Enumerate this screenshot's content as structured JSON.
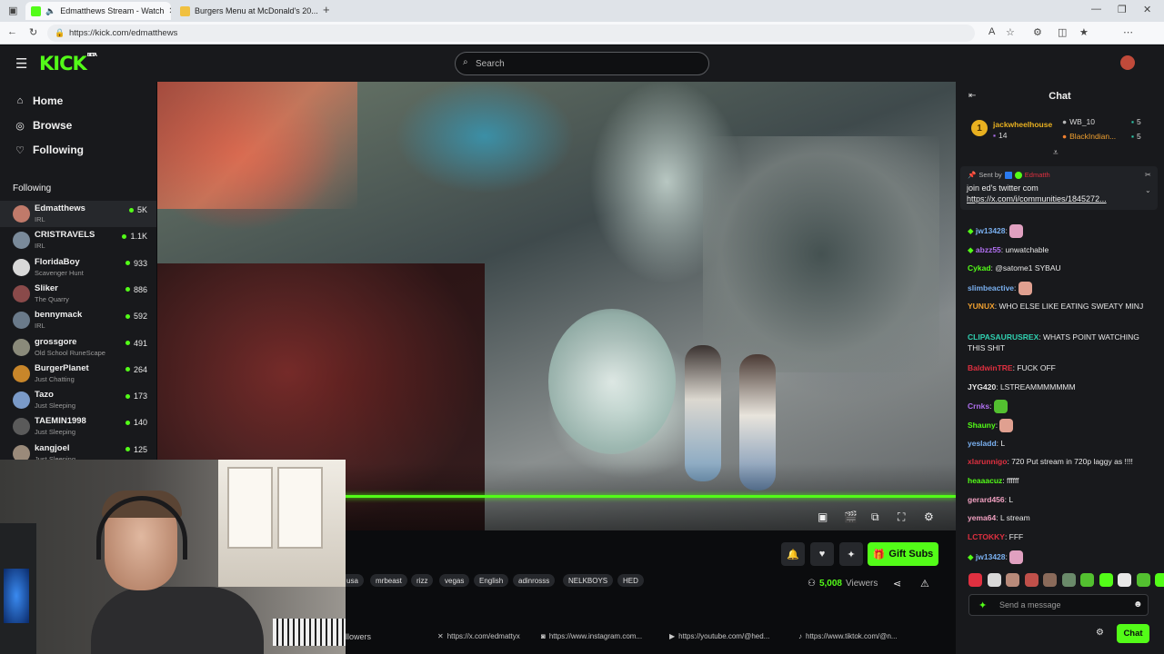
{
  "browser": {
    "tabs": [
      {
        "title": "Edmatthews Stream - Watch",
        "active": true
      },
      {
        "title": "Burgers Menu at McDonald's 20...",
        "active": false
      }
    ],
    "url": "https://kick.com/edmatthews",
    "new_tab_icon": "plus-icon"
  },
  "header": {
    "logo": "KICK",
    "logo_badge": "BETA",
    "search_placeholder": "Search"
  },
  "sidebar": {
    "nav": [
      {
        "label": "Home",
        "icon": "home-icon"
      },
      {
        "label": "Browse",
        "icon": "compass-icon"
      },
      {
        "label": "Following",
        "icon": "heart-icon"
      }
    ],
    "following_title": "Following",
    "channels": [
      {
        "name": "Edmatthews",
        "category": "IRL",
        "viewers": "5K",
        "color": "#c07a6a"
      },
      {
        "name": "CRISTRAVELS",
        "category": "IRL",
        "viewers": "1.1K",
        "color": "#7a8a9a"
      },
      {
        "name": "FloridaBoy",
        "category": "Scavenger Hunt",
        "viewers": "933",
        "color": "#d8d8d8"
      },
      {
        "name": "Sliker",
        "category": "The Quarry",
        "viewers": "886",
        "color": "#8a4a4a"
      },
      {
        "name": "bennymack",
        "category": "IRL",
        "viewers": "592",
        "color": "#6a7a8a"
      },
      {
        "name": "grossgore",
        "category": "Old School RuneScape",
        "viewers": "491",
        "color": "#8a8a7a"
      },
      {
        "name": "BurgerPlanet",
        "category": "Just Chatting",
        "viewers": "264",
        "color": "#c8862a"
      },
      {
        "name": "Tazo",
        "category": "Just Sleeping",
        "viewers": "173",
        "color": "#7a9ac8"
      },
      {
        "name": "TAEMIN1998",
        "category": "Just Sleeping",
        "viewers": "140",
        "color": "#5a5a5a"
      },
      {
        "name": "kangjoel",
        "category": "Just Sleeping",
        "viewers": "125",
        "color": "#9a8a7a"
      }
    ]
  },
  "stream": {
    "tags": [
      "usa",
      "mrbeast",
      "rizz",
      "vegas",
      "English",
      "adinrosss",
      "NELKBOYS",
      "HED"
    ],
    "viewers_count": "5,008",
    "viewers_label": "Viewers",
    "gift_subs_label": "Gift Subs",
    "followers_label": "llowers",
    "social_links": [
      {
        "icon": "x-icon",
        "text": "https://x.com/edmattyx"
      },
      {
        "icon": "instagram-icon",
        "text": "https://www.instagram.com..."
      },
      {
        "icon": "youtube-icon",
        "text": "https://youtube.com/@hed..."
      },
      {
        "icon": "tiktok-icon",
        "text": "https://www.tiktok.com/@n..."
      }
    ]
  },
  "chat": {
    "title": "Chat",
    "leaderboard": [
      {
        "rank": "1",
        "name": "jackwheelhouse",
        "sub": "14"
      },
      {
        "name": "WB_10",
        "value": "5"
      },
      {
        "name": "BlackIndian...",
        "value": "5"
      }
    ],
    "pinned": {
      "sent_by_label": "Sent by",
      "sender": "Edmatth",
      "text_line1": "join ed's twitter com",
      "text_line2": "https://x.com/i/communities/1845272..."
    },
    "messages": [
      {
        "user": "jw13428",
        "color": "#7ab0f0",
        "text": "",
        "emote": "#e0a0c0",
        "badge": true
      },
      {
        "user": "abzz55",
        "color": "#b070f0",
        "text": "unwatchable",
        "badge": true
      },
      {
        "user": "Cykad",
        "color": "#53fc18",
        "text": "@satome1 SYBAU"
      },
      {
        "user": "slimbeactive",
        "color": "#7ab0f0",
        "text": "",
        "emote": "#e0a090"
      },
      {
        "user": "YUNUX",
        "color": "#f0a030",
        "text": "WHO ELSE LIKE EATING SWEATY MINJ"
      },
      {
        "user": "CLIPASAURUSREX",
        "color": "#30d0b0",
        "text": "WHATS POINT WATCHING THIS SHIT"
      },
      {
        "user": "BaldwinTRE",
        "color": "#e03040",
        "text": "FUCK OFF"
      },
      {
        "user": "JYG420",
        "color": "#e8e8e8",
        "text": "LSTREAMMMMMMM"
      },
      {
        "user": "Crnks",
        "color": "#b070f0",
        "text": "",
        "emote": "#53c030"
      },
      {
        "user": "Shauny",
        "color": "#53fc18",
        "text": "",
        "emote": "#e0a090"
      },
      {
        "user": "yesladd",
        "color": "#7ab0f0",
        "text": "L"
      },
      {
        "user": "xlarunnigo",
        "color": "#e03040",
        "text": "720 Put stream in 720p laggy as !!!!"
      },
      {
        "user": "heaaacuz",
        "color": "#53fc18",
        "text": "ffffff"
      },
      {
        "user": "gerard456",
        "color": "#f0a0c0",
        "text": "L"
      },
      {
        "user": "yema64",
        "color": "#f0a0c0",
        "text": "L stream"
      },
      {
        "user": "LCTOKKY",
        "color": "#e03040",
        "text": "FFF"
      },
      {
        "user": "jw13428",
        "color": "#7ab0f0",
        "text": "",
        "emote": "#e0a0c0",
        "badge": true
      }
    ],
    "input_placeholder": "Send a message",
    "send_label": "Chat"
  },
  "colors": {
    "accent": "#53fc18",
    "panel": "#18191c",
    "background": "#0b0c0e"
  }
}
